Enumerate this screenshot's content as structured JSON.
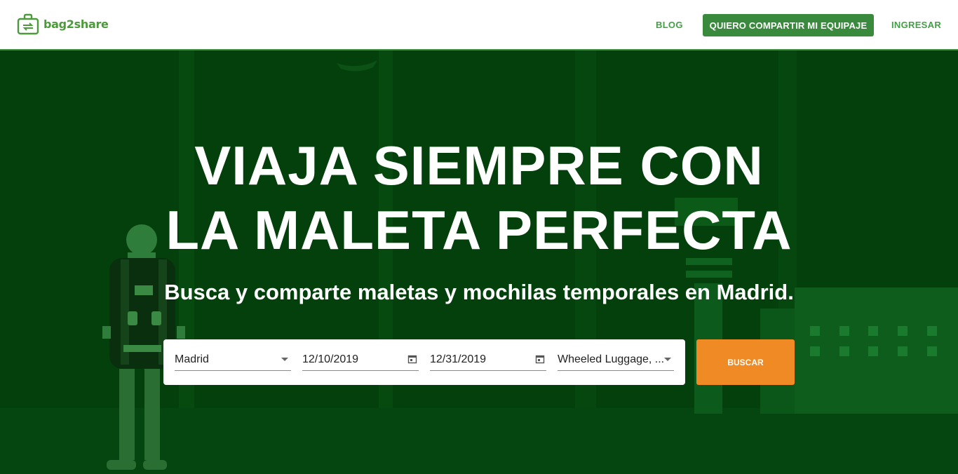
{
  "brand": {
    "name": "bag2share",
    "color": "#4c9a3c"
  },
  "nav": {
    "blog": "BLOG",
    "cta": "QUIERO COMPARTIR MI EQUIPAJE",
    "login": "INGRESAR"
  },
  "hero": {
    "title_line1": "VIAJA SIEMPRE CON",
    "title_line2": "LA MALETA PERFECTA",
    "subtitle": "Busca y comparte maletas y mochilas temporales en Madrid."
  },
  "search": {
    "city": "Madrid",
    "date_from": "12/10/2019",
    "date_to": "12/31/2019",
    "category": "Wheeled Luggage, ...",
    "button": "BUSCAR"
  },
  "colors": {
    "hero_bg": "#03400b",
    "accent_green": "#3a8a3d",
    "button_orange": "#f08a24"
  },
  "icons": [
    "bag2share-logo-icon",
    "chevron-down-icon",
    "calendar-icon",
    "traveler-illustration",
    "building-illustration"
  ]
}
